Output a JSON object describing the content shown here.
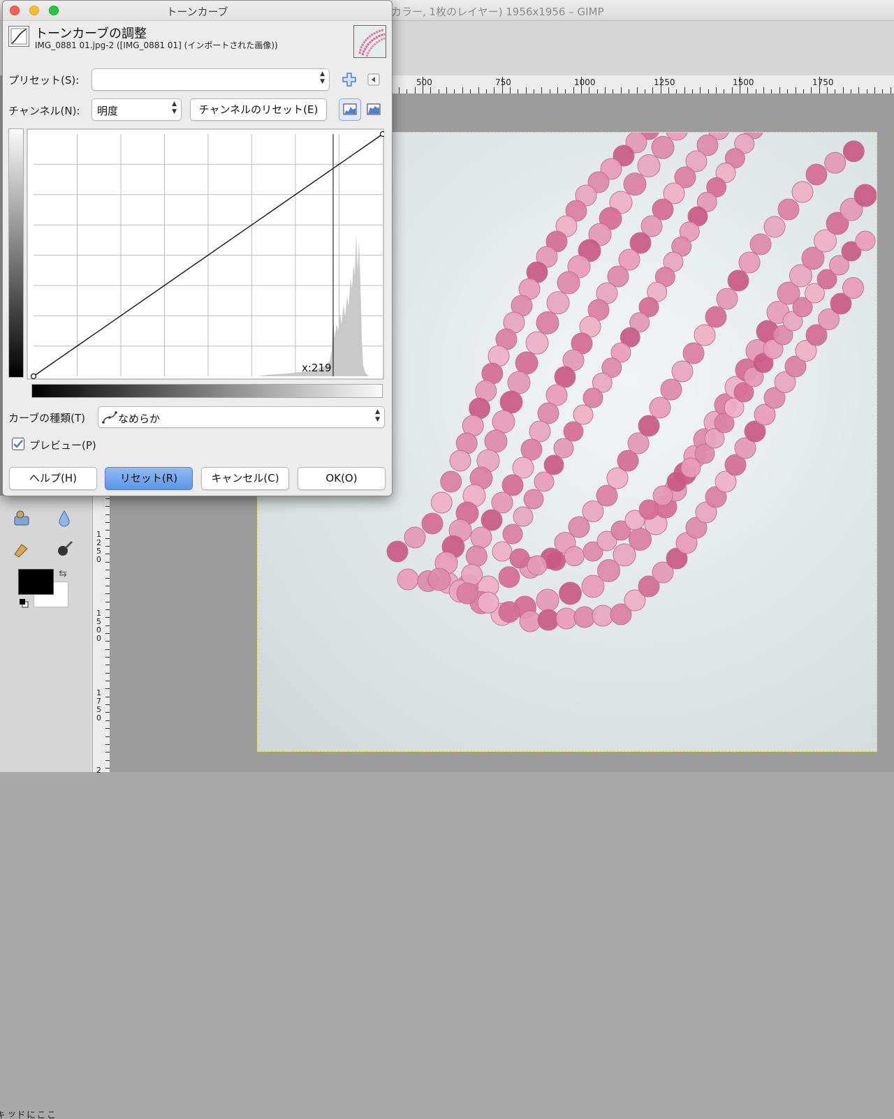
{
  "main_window": {
    "title": "カラー, 1枚のレイヤー) 1956x1956 – GIMP",
    "ruler_labels": [
      "500",
      "750",
      "1000",
      "1250",
      "1500",
      "1750"
    ],
    "vruler_labels": [
      "1250",
      "1500",
      "1750",
      "2"
    ]
  },
  "toolbox": {
    "dock_hint": "ここにドッキング可能なダイアログを"
  },
  "dialog": {
    "window_title": "トーンカーブ",
    "header_title": "トーンカーブの調整",
    "header_subtitle": "IMG_0881 01.jpg-2 ([IMG_0881 01] (インポートされた画像))",
    "preset_label": "プリセット(S):",
    "preset_value": "",
    "channel_label": "チャンネル(N):",
    "channel_value": "明度",
    "reset_channel_button": "チャンネルのリセット(E)",
    "cursor_readout": "x:219",
    "curve_type_label": "カーブの種類(T)",
    "curve_type_value": "なめらか",
    "preview_label": "プレビュー(P)",
    "preview_checked": true,
    "buttons": {
      "help": "ヘルプ(H)",
      "reset": "リセット(R)",
      "cancel": "キャンセル(C)",
      "ok": "OK(O)"
    }
  },
  "colors": {
    "primary_button": "#5d95e6",
    "selection_outline": "#e9e200",
    "bead_pink": "#e07aa0"
  }
}
